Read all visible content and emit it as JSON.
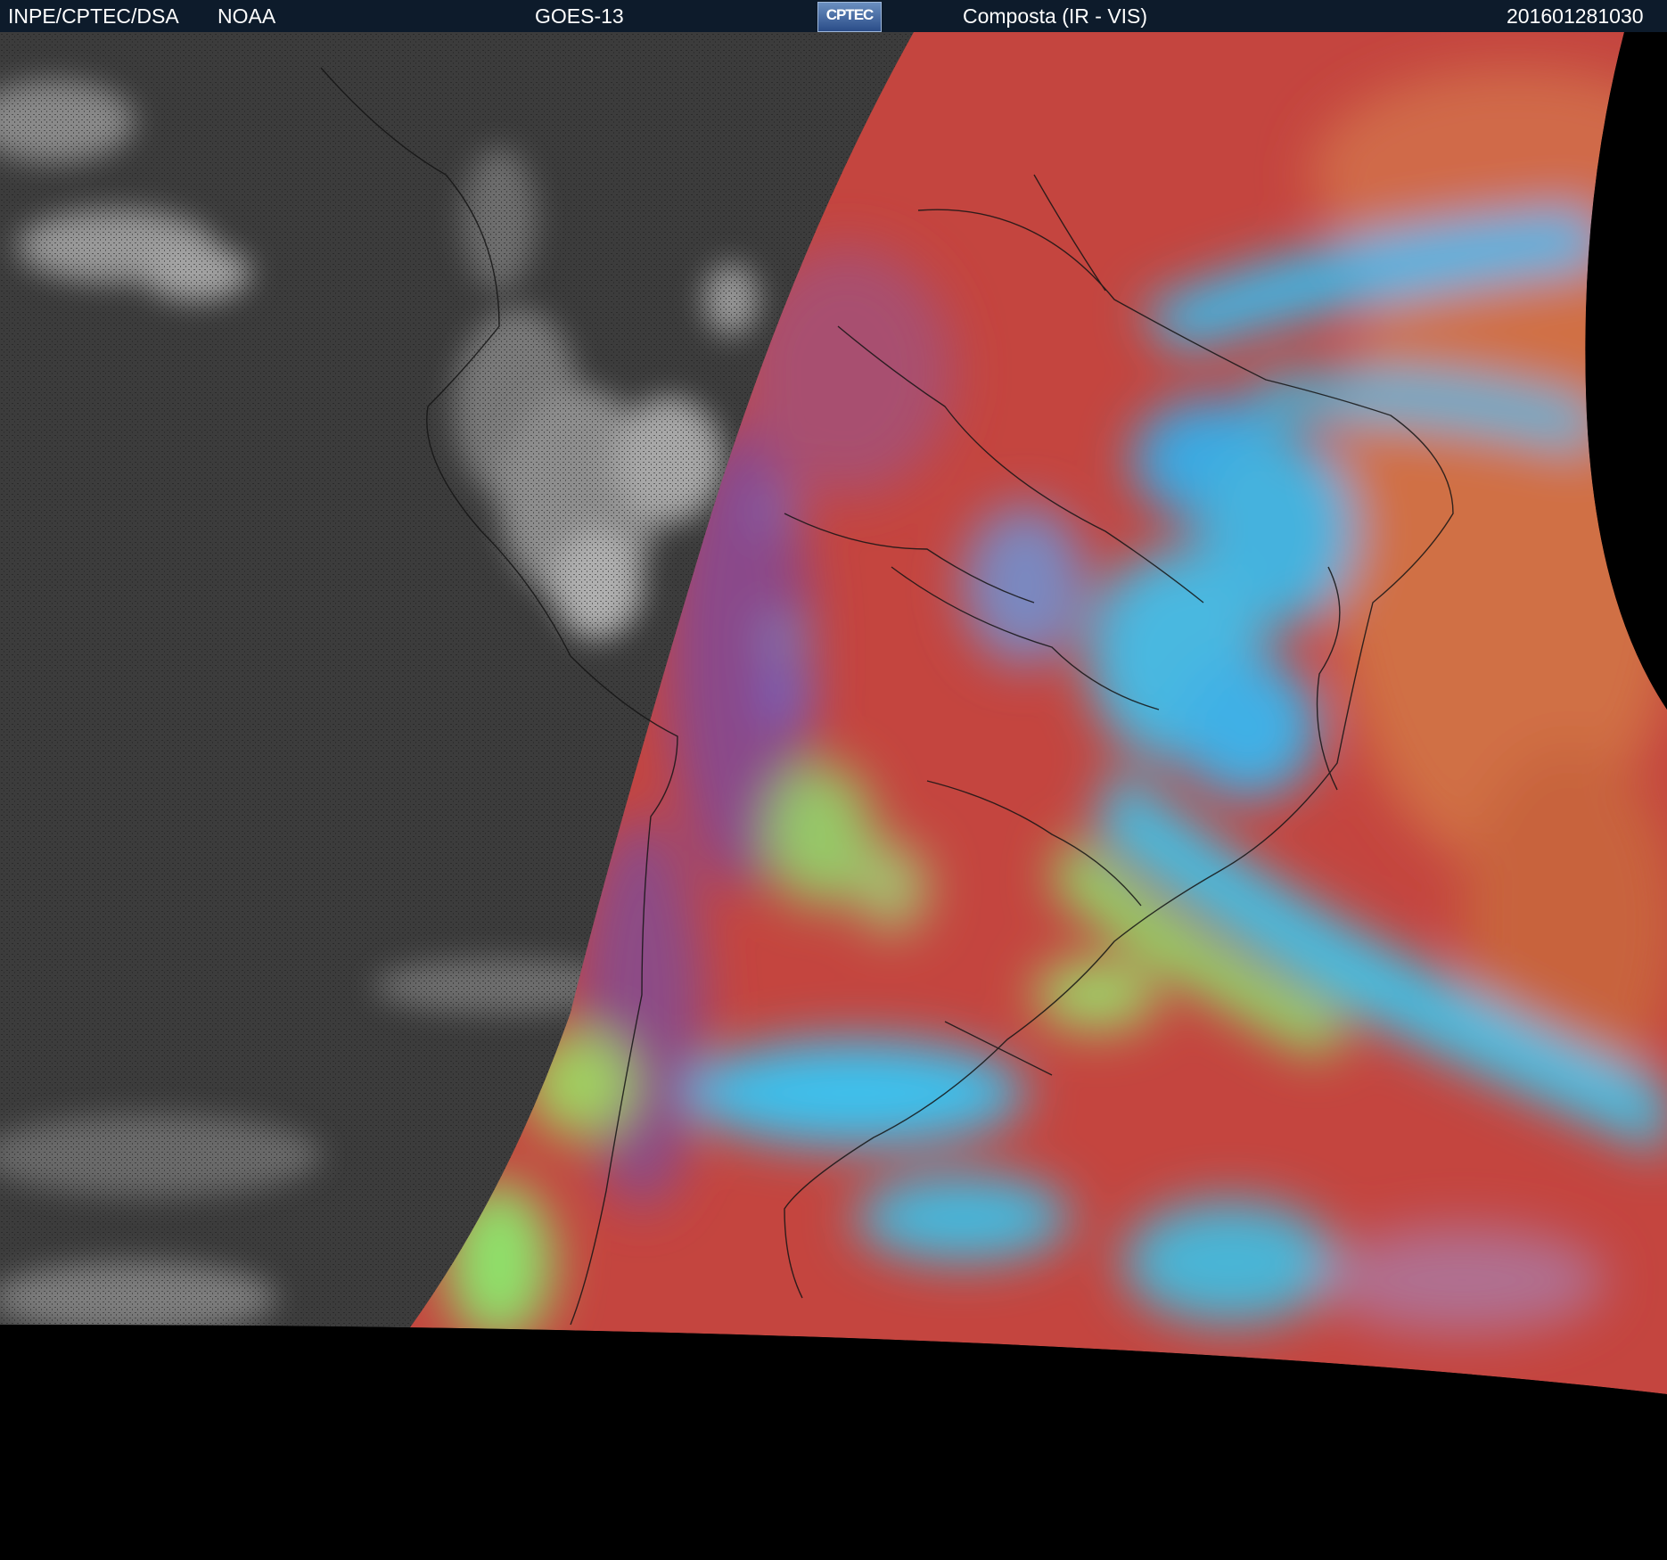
{
  "header": {
    "source_label": "INPE/CPTEC/DSA",
    "agency_label": "NOAA",
    "satellite_label": "GOES-13",
    "logo_text": "CPTEC",
    "product_label": "Composta (IR - VIS)",
    "timestamp": "201601281030"
  },
  "colors": {
    "header_bg": "#0d1b2b",
    "night_side": "#3c3c3c",
    "day_side": "#c4453f",
    "ocean_orange": "#cf6a44",
    "cloud_cyan": "#3ab8e8",
    "cloud_green": "#8fe06a",
    "space": "#000000"
  },
  "icons": [
    "cptec-logo-icon"
  ]
}
